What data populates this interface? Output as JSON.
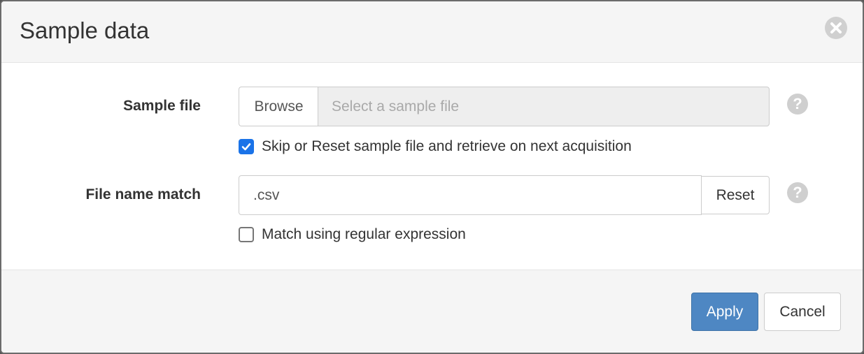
{
  "dialog": {
    "title": "Sample data",
    "close_icon": "close-icon"
  },
  "form": {
    "sample_file": {
      "label": "Sample file",
      "browse_label": "Browse",
      "placeholder": "Select a sample file",
      "help_icon": "question-circle-icon",
      "help_glyph": "?"
    },
    "skip_reset": {
      "label": "Skip or Reset sample file and retrieve on next acquisition",
      "checked": true
    },
    "file_name_match": {
      "label": "File name match",
      "value": ".csv",
      "reset_label": "Reset",
      "help_icon": "question-circle-icon",
      "help_glyph": "?"
    },
    "regex": {
      "label": "Match using regular expression",
      "checked": false
    }
  },
  "footer": {
    "apply_label": "Apply",
    "cancel_label": "Cancel"
  },
  "colors": {
    "primary": "#4e87c3",
    "checkbox_accent": "#1a73e8",
    "header_bg": "#f5f5f5"
  }
}
